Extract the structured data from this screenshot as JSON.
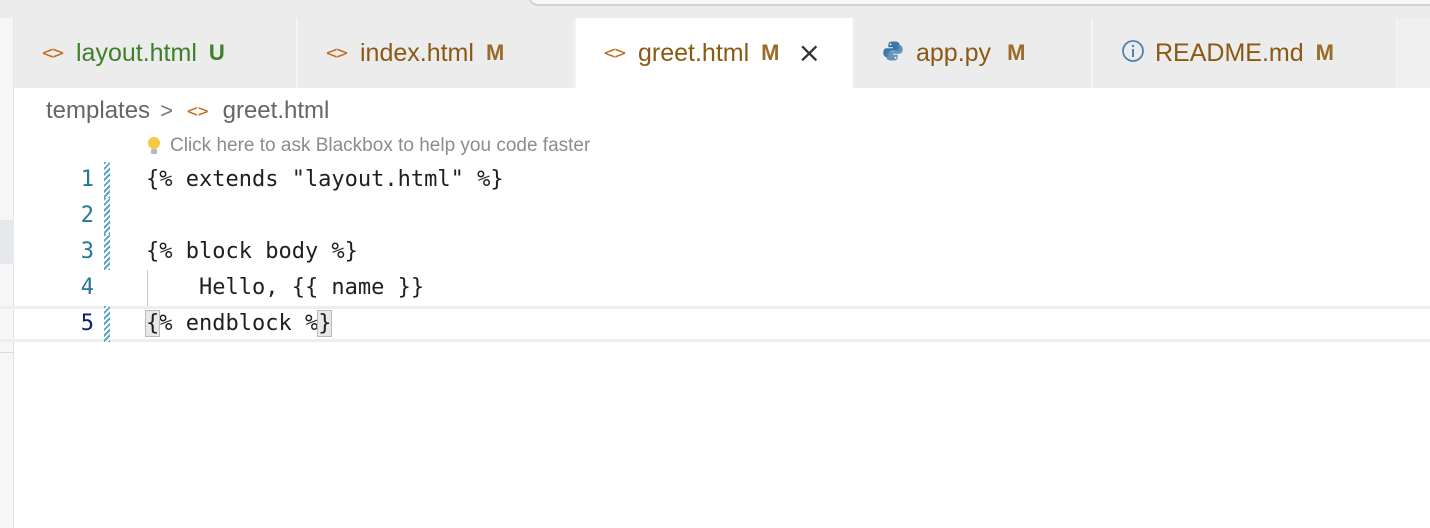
{
  "tabs": [
    {
      "icon": "<>",
      "label": "layout.html",
      "status": "U",
      "label_color": "#3f7f2a",
      "status_color": "#3f7f2a",
      "icon_color": "#c06a1c",
      "active": false
    },
    {
      "icon": "<>",
      "label": "index.html",
      "status": "M",
      "label_color": "#8a5a14",
      "status_color": "#9b6b2a",
      "icon_color": "#c06a1c",
      "active": false
    },
    {
      "icon": "<>",
      "label": "greet.html",
      "status": "M",
      "label_color": "#8a5a14",
      "status_color": "#9b6b2a",
      "icon_color": "#c06a1c",
      "active": true
    },
    {
      "icon": "python-icon",
      "label": "app.py",
      "status": "M",
      "label_color": "#8a5a14",
      "status_color": "#9b6b2a",
      "active": false
    },
    {
      "icon": "info-icon",
      "label": "README.md",
      "status": "M",
      "label_color": "#8a5a14",
      "status_color": "#9b6b2a",
      "icon_color": "#4a86b8",
      "active": false
    }
  ],
  "breadcrumb": {
    "folder": "templates",
    "separator": ">",
    "file_icon": "<>",
    "file": "greet.html"
  },
  "hint": {
    "text": "Click here to ask Blackbox to help you code faster"
  },
  "editor": {
    "lines": [
      {
        "number": "1",
        "code": "{% extends \"layout.html\" %}"
      },
      {
        "number": "2",
        "code": ""
      },
      {
        "number": "3",
        "code": "{% block body %}"
      },
      {
        "number": "4",
        "code": "    Hello, {{ name }}"
      },
      {
        "number": "5",
        "code_start": "{",
        "code_mid": "% endblock %",
        "code_end": "}"
      }
    ],
    "current_line": 5
  }
}
